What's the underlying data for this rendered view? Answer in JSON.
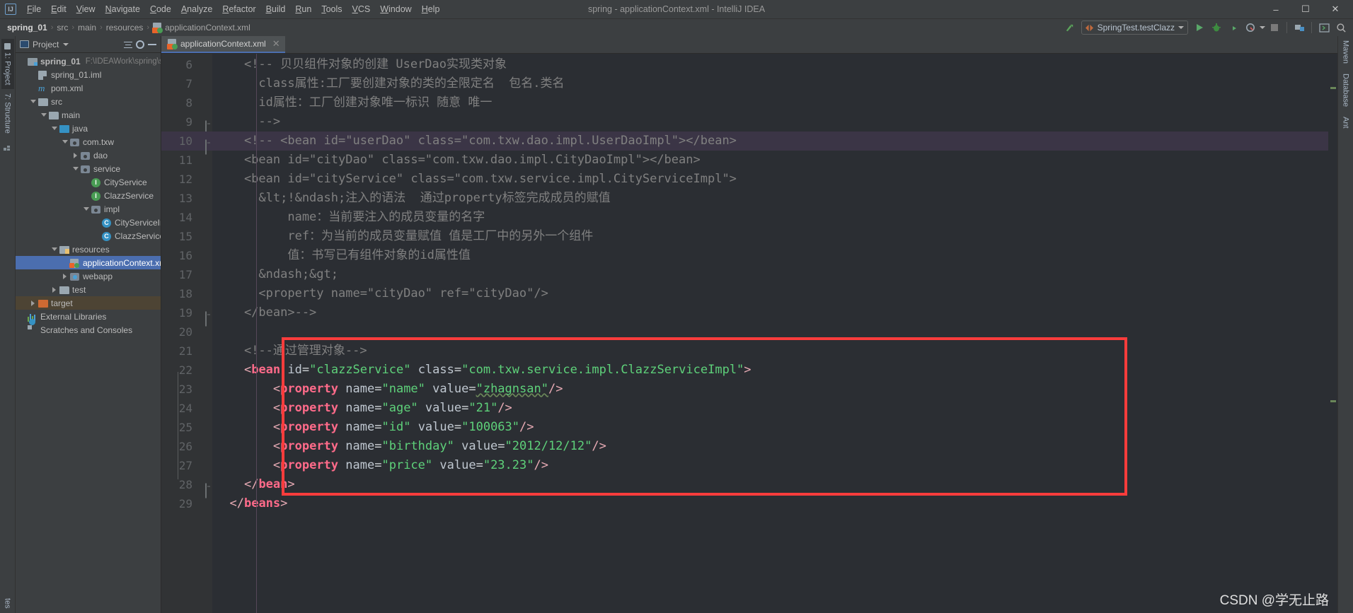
{
  "window": {
    "title": "spring - applicationContext.xml - IntelliJ IDEA",
    "logo": "IJ",
    "minimize": "–",
    "maximize": "☐",
    "close": "✕"
  },
  "menu": {
    "items": [
      {
        "label": "File"
      },
      {
        "label": "Edit"
      },
      {
        "label": "View"
      },
      {
        "label": "Navigate"
      },
      {
        "label": "Code"
      },
      {
        "label": "Analyze"
      },
      {
        "label": "Refactor"
      },
      {
        "label": "Build"
      },
      {
        "label": "Run"
      },
      {
        "label": "Tools"
      },
      {
        "label": "VCS"
      },
      {
        "label": "Window"
      },
      {
        "label": "Help"
      }
    ]
  },
  "breadcrumb": {
    "items": [
      "spring_01",
      "src",
      "main",
      "resources",
      "applicationContext.xml"
    ],
    "separator": "›"
  },
  "toolbar": {
    "run_config": "SpringTest.testClazz",
    "run_button": "▶",
    "debug_button": "debug-icon",
    "run_coverage_button": "run-with-coverage-icon",
    "profile_button": "profile-icon",
    "stop_button": "■",
    "build_button": "build-icon",
    "terminal_button": "terminal-icon",
    "search_button": "⌕",
    "updown_button": "update-icon"
  },
  "left_strips": [
    {
      "label": "1: Project",
      "active": true
    },
    {
      "label": "7: Structure",
      "active": false
    }
  ],
  "right_strips": [
    {
      "label": "Maven"
    },
    {
      "label": "Database"
    },
    {
      "label": "Ant"
    }
  ],
  "bottom_strip": {
    "label": "tes"
  },
  "project_panel": {
    "title": "Project",
    "collapse_all": "collapse-all-icon",
    "settings": "gear-icon",
    "hide": "hide-icon",
    "tree": [
      {
        "label": "spring_01",
        "path": "F:\\IDEAWork\\spring\\spring_",
        "indent": 0,
        "arrow": "none",
        "icon": "module-folder",
        "bold": true
      },
      {
        "label": "spring_01.iml",
        "indent": 1,
        "arrow": "none",
        "icon": "iml-file"
      },
      {
        "label": "pom.xml",
        "indent": 1,
        "arrow": "none",
        "icon": "maven-m"
      },
      {
        "label": "src",
        "indent": 1,
        "arrow": "down",
        "icon": "folder"
      },
      {
        "label": "main",
        "indent": 2,
        "arrow": "down",
        "icon": "folder"
      },
      {
        "label": "java",
        "indent": 3,
        "arrow": "down",
        "icon": "source-folder"
      },
      {
        "label": "com.txw",
        "indent": 4,
        "arrow": "down",
        "icon": "package"
      },
      {
        "label": "dao",
        "indent": 5,
        "arrow": "right",
        "icon": "package"
      },
      {
        "label": "service",
        "indent": 5,
        "arrow": "down",
        "icon": "package"
      },
      {
        "label": "CityService",
        "indent": 6,
        "arrow": "none",
        "icon": "interface"
      },
      {
        "label": "ClazzService",
        "indent": 6,
        "arrow": "none",
        "icon": "interface"
      },
      {
        "label": "impl",
        "indent": 6,
        "arrow": "down",
        "icon": "package"
      },
      {
        "label": "CityServiceImpl",
        "indent": 7,
        "arrow": "none",
        "icon": "class"
      },
      {
        "label": "ClazzServiceImpl",
        "indent": 7,
        "arrow": "none",
        "icon": "class"
      },
      {
        "label": "resources",
        "indent": 3,
        "arrow": "down",
        "icon": "resource-folder"
      },
      {
        "label": "applicationContext.xml",
        "indent": 4,
        "arrow": "none",
        "icon": "xml-file",
        "selected": true
      },
      {
        "label": "webapp",
        "indent": 4,
        "arrow": "right",
        "icon": "webapp-folder"
      },
      {
        "label": "test",
        "indent": 3,
        "arrow": "right",
        "icon": "folder"
      },
      {
        "label": "target",
        "indent": 1,
        "arrow": "right",
        "icon": "target-folder",
        "highlight": true
      },
      {
        "label": "External Libraries",
        "indent": 0,
        "arrow": "none",
        "icon": "external-libraries"
      },
      {
        "label": "Scratches and Consoles",
        "indent": 0,
        "arrow": "none",
        "icon": "scratches"
      }
    ]
  },
  "editor": {
    "tab": {
      "label": "applicationContext.xml",
      "close": "✕"
    },
    "first_visible_line": 6,
    "lines": [
      {
        "n": 6,
        "fold": "top-partial",
        "tokens": [
          {
            "t": "    ",
            "c": "plain"
          },
          {
            "t": "<!-- 贝贝组件对象的创建 UserDao实现类对象",
            "c": "cmt"
          }
        ]
      },
      {
        "n": 7,
        "tokens": [
          {
            "t": "      class属性:工厂要创建对象的类的全限定名  包名.类名",
            "c": "cmt"
          }
        ]
      },
      {
        "n": 8,
        "tokens": [
          {
            "t": "      id属性：工厂创建对象唯一标识 随意 唯一",
            "c": "cmt"
          }
        ]
      },
      {
        "n": 9,
        "fold": "bottom",
        "tokens": [
          {
            "t": "      -->",
            "c": "cmt"
          }
        ]
      },
      {
        "n": 10,
        "highlight": true,
        "fold": "bottom2",
        "tokens": [
          {
            "t": "    <!-- <bean id=\"userDao\" class=\"com.txw.dao.impl.UserDaoImpl\"></bean>",
            "c": "cmt"
          }
        ]
      },
      {
        "n": 11,
        "tokens": [
          {
            "t": "    <bean id=\"cityDao\" class=\"com.txw.dao.impl.CityDaoImpl\"></bean>",
            "c": "cmt"
          }
        ]
      },
      {
        "n": 12,
        "tokens": [
          {
            "t": "    <bean id=\"cityService\" class=\"com.txw.service.impl.CityServiceImpl\">",
            "c": "cmt"
          }
        ]
      },
      {
        "n": 13,
        "tokens": [
          {
            "t": "      &lt;!&ndash;注入的语法  通过property标签完成成员的赋值",
            "c": "cmt"
          }
        ]
      },
      {
        "n": 14,
        "tokens": [
          {
            "t": "          name：当前要注入的成员变量的名字",
            "c": "cmt"
          }
        ]
      },
      {
        "n": 15,
        "tokens": [
          {
            "t": "          ref：为当前的成员变量赋值 值是工厂中的另外一个组件",
            "c": "cmt"
          }
        ]
      },
      {
        "n": 16,
        "tokens": [
          {
            "t": "          值：书写已有组件对象的id属性值",
            "c": "cmt"
          }
        ]
      },
      {
        "n": 17,
        "tokens": [
          {
            "t": "      &ndash;&gt;",
            "c": "cmt"
          }
        ]
      },
      {
        "n": 18,
        "tokens": [
          {
            "t": "      <property name=\"cityDao\" ref=\"cityDao\"/>",
            "c": "cmt"
          }
        ]
      },
      {
        "n": 19,
        "fold": "bottom",
        "tokens": [
          {
            "t": "    </bean>-->",
            "c": "cmt"
          }
        ]
      },
      {
        "n": 20,
        "tokens": [
          {
            "t": "",
            "c": "plain"
          }
        ]
      },
      {
        "n": 21,
        "tokens": [
          {
            "t": "    ",
            "c": "plain"
          },
          {
            "t": "<!--通过管理对象-->",
            "c": "cmt"
          }
        ]
      },
      {
        "n": 22,
        "fold": "top",
        "tokens": [
          {
            "t": "    ",
            "c": "plain"
          },
          {
            "t": "<",
            "c": "tag"
          },
          {
            "t": "bean",
            "c": "tagname"
          },
          {
            "t": " ",
            "c": "plain"
          },
          {
            "t": "id",
            "c": "attr"
          },
          {
            "t": "=",
            "c": "punc"
          },
          {
            "t": "\"clazzService\"",
            "c": "valg"
          },
          {
            "t": " ",
            "c": "plain"
          },
          {
            "t": "class",
            "c": "attr"
          },
          {
            "t": "=",
            "c": "punc"
          },
          {
            "t": "\"com.txw.service.impl.ClazzServiceImpl\"",
            "c": "valg"
          },
          {
            "t": ">",
            "c": "tag"
          }
        ]
      },
      {
        "n": 23,
        "tokens": [
          {
            "t": "        ",
            "c": "plain"
          },
          {
            "t": "<",
            "c": "tag"
          },
          {
            "t": "property",
            "c": "tagname"
          },
          {
            "t": " ",
            "c": "plain"
          },
          {
            "t": "name",
            "c": "attr"
          },
          {
            "t": "=",
            "c": "punc"
          },
          {
            "t": "\"name\"",
            "c": "valg"
          },
          {
            "t": " ",
            "c": "plain"
          },
          {
            "t": "value",
            "c": "attr"
          },
          {
            "t": "=",
            "c": "punc"
          },
          {
            "t": "\"zhagnsan\"",
            "c": "valg-typo"
          },
          {
            "t": "/>",
            "c": "tag"
          }
        ]
      },
      {
        "n": 24,
        "tokens": [
          {
            "t": "        ",
            "c": "plain"
          },
          {
            "t": "<",
            "c": "tag"
          },
          {
            "t": "property",
            "c": "tagname"
          },
          {
            "t": " ",
            "c": "plain"
          },
          {
            "t": "name",
            "c": "attr"
          },
          {
            "t": "=",
            "c": "punc"
          },
          {
            "t": "\"age\"",
            "c": "valg"
          },
          {
            "t": " ",
            "c": "plain"
          },
          {
            "t": "value",
            "c": "attr"
          },
          {
            "t": "=",
            "c": "punc"
          },
          {
            "t": "\"21\"",
            "c": "valg"
          },
          {
            "t": "/>",
            "c": "tag"
          }
        ]
      },
      {
        "n": 25,
        "tokens": [
          {
            "t": "        ",
            "c": "plain"
          },
          {
            "t": "<",
            "c": "tag"
          },
          {
            "t": "property",
            "c": "tagname"
          },
          {
            "t": " ",
            "c": "plain"
          },
          {
            "t": "name",
            "c": "attr"
          },
          {
            "t": "=",
            "c": "punc"
          },
          {
            "t": "\"id\"",
            "c": "valg"
          },
          {
            "t": " ",
            "c": "plain"
          },
          {
            "t": "value",
            "c": "attr"
          },
          {
            "t": "=",
            "c": "punc"
          },
          {
            "t": "\"100063\"",
            "c": "valg"
          },
          {
            "t": "/>",
            "c": "tag"
          }
        ]
      },
      {
        "n": 26,
        "tokens": [
          {
            "t": "        ",
            "c": "plain"
          },
          {
            "t": "<",
            "c": "tag"
          },
          {
            "t": "property",
            "c": "tagname"
          },
          {
            "t": " ",
            "c": "plain"
          },
          {
            "t": "name",
            "c": "attr"
          },
          {
            "t": "=",
            "c": "punc"
          },
          {
            "t": "\"birthday\"",
            "c": "valg"
          },
          {
            "t": " ",
            "c": "plain"
          },
          {
            "t": "value",
            "c": "attr"
          },
          {
            "t": "=",
            "c": "punc"
          },
          {
            "t": "\"2012/12/12\"",
            "c": "valg"
          },
          {
            "t": "/>",
            "c": "tag"
          }
        ]
      },
      {
        "n": 27,
        "tokens": [
          {
            "t": "        ",
            "c": "plain"
          },
          {
            "t": "<",
            "c": "tag"
          },
          {
            "t": "property",
            "c": "tagname"
          },
          {
            "t": " ",
            "c": "plain"
          },
          {
            "t": "name",
            "c": "attr"
          },
          {
            "t": "=",
            "c": "punc"
          },
          {
            "t": "\"price\"",
            "c": "valg"
          },
          {
            "t": " ",
            "c": "plain"
          },
          {
            "t": "value",
            "c": "attr"
          },
          {
            "t": "=",
            "c": "punc"
          },
          {
            "t": "\"23.23\"",
            "c": "valg"
          },
          {
            "t": "/>",
            "c": "tag"
          }
        ]
      },
      {
        "n": 28,
        "fold": "bottom",
        "tokens": [
          {
            "t": "    ",
            "c": "plain"
          },
          {
            "t": "</",
            "c": "tag"
          },
          {
            "t": "bean",
            "c": "tagname"
          },
          {
            "t": ">",
            "c": "tag"
          }
        ]
      },
      {
        "n": 29,
        "tokens": [
          {
            "t": "  ",
            "c": "plain"
          },
          {
            "t": "</",
            "c": "tag"
          },
          {
            "t": "beans",
            "c": "tagname"
          },
          {
            "t": ">",
            "c": "tag"
          }
        ]
      }
    ]
  },
  "annotation": {
    "box_color": "#fa3c3c"
  },
  "watermark": "CSDN @学无止路",
  "colors": {
    "accent": "#4b6eaf",
    "selection": "#4b6eaf",
    "editor_bg": "#2b2e33",
    "panel_bg": "#3c3f41",
    "comment": "#808080",
    "tag": "#ff6b8a",
    "value": "#5ed17a",
    "highlight_line": "#3b3546",
    "target_row": "#4d4434"
  }
}
